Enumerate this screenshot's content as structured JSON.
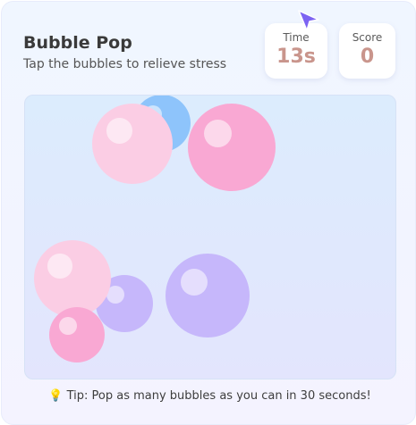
{
  "header": {
    "title": "Bubble Pop",
    "subtitle": "Tap the bubbles to relieve stress"
  },
  "stats": {
    "time_label": "Time",
    "time_value": "13s",
    "score_label": "Score",
    "score_value": "0"
  },
  "cursor_icon": "pointer-arrow-icon",
  "bubbles": [
    {
      "color": "blue",
      "hex": "#8ec4fb"
    },
    {
      "color": "light-pink",
      "hex": "#fbcde4"
    },
    {
      "color": "pink",
      "hex": "#f9a8d3"
    },
    {
      "color": "lavender",
      "hex": "#c6b7fb"
    },
    {
      "color": "light-pink",
      "hex": "#fbcde4"
    },
    {
      "color": "pink",
      "hex": "#f9a8d3"
    },
    {
      "color": "lavender",
      "hex": "#c6b7fb"
    }
  ],
  "tip": {
    "icon": "lightbulb-icon",
    "icon_glyph": "💡",
    "text": "Tip: Pop as many bubbles as you can in 30 seconds!"
  }
}
